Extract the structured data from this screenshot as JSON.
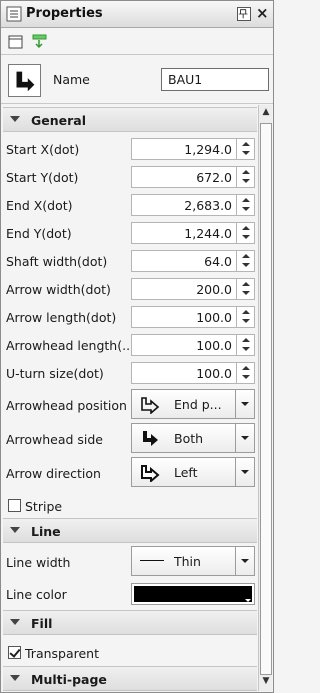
{
  "window": {
    "title": "Properties"
  },
  "header": {
    "name_label": "Name",
    "name_value": "BAU1"
  },
  "sections": {
    "general": "General",
    "line": "Line",
    "fill": "Fill",
    "multipage": "Multi-page"
  },
  "fields": [
    {
      "label": "Start X(dot)",
      "value": "1,294.0"
    },
    {
      "label": "Start Y(dot)",
      "value": "672.0"
    },
    {
      "label": "End X(dot)",
      "value": "2,683.0"
    },
    {
      "label": "End Y(dot)",
      "value": "1,244.0"
    },
    {
      "label": "Shaft width(dot)",
      "value": "64.0"
    },
    {
      "label": "Arrow width(dot)",
      "value": "200.0"
    },
    {
      "label": "Arrow length(dot)",
      "value": "100.0"
    },
    {
      "label": "Arrowhead length(...",
      "value": "100.0"
    },
    {
      "label": "U-turn size(dot)",
      "value": "100.0"
    }
  ],
  "combos": {
    "position": {
      "label": "Arrowhead position",
      "value": "End p..."
    },
    "side": {
      "label": "Arrowhead side",
      "value": "Both"
    },
    "direction": {
      "label": "Arrow direction",
      "value": "Left"
    }
  },
  "stripe": {
    "label": "Stripe",
    "checked": false
  },
  "line": {
    "width_label": "Line width",
    "width_value": "Thin",
    "color_label": "Line color",
    "color": "#000000"
  },
  "fill": {
    "transparent_label": "Transparent",
    "checked": true
  }
}
